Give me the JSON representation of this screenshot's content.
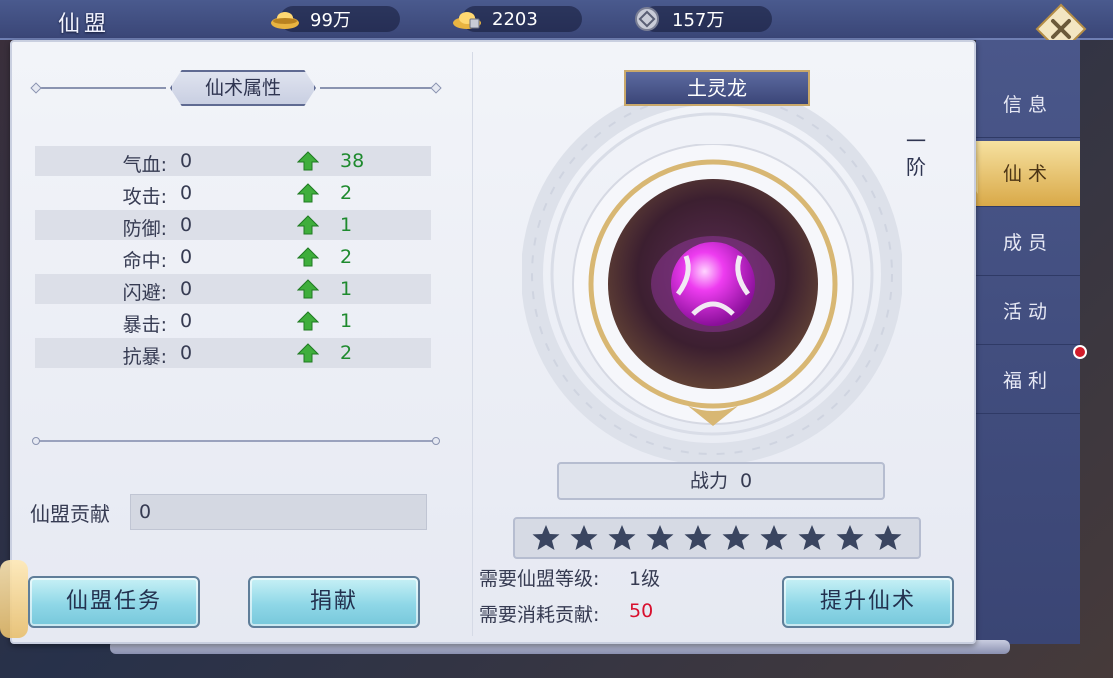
{
  "topbar": {
    "title": "仙盟",
    "resources": [
      {
        "icon": "gold-ingot-icon",
        "value": "99万"
      },
      {
        "icon": "locked-ingot-icon",
        "value": "2203"
      },
      {
        "icon": "coin-icon",
        "value": "157万"
      }
    ]
  },
  "left": {
    "section_title": "仙术属性",
    "attributes": [
      {
        "name": "气血:",
        "value": "0",
        "increase": "38"
      },
      {
        "name": "攻击:",
        "value": "0",
        "increase": "2"
      },
      {
        "name": "防御:",
        "value": "0",
        "increase": "1"
      },
      {
        "name": "命中:",
        "value": "0",
        "increase": "2"
      },
      {
        "name": "闪避:",
        "value": "0",
        "increase": "1"
      },
      {
        "name": "暴击:",
        "value": "0",
        "increase": "1"
      },
      {
        "name": "抗暴:",
        "value": "0",
        "increase": "2"
      }
    ],
    "contribution_label": "仙盟贡献",
    "contribution_value": "0",
    "buttons": {
      "task": "仙盟任务",
      "donate": "捐献"
    }
  },
  "right": {
    "pet_name": "土灵龙",
    "rank": "一阶",
    "power_label": "战力",
    "power_value": "0",
    "stars_total": 10,
    "stars_filled": 0,
    "requirements": [
      {
        "label": "需要仙盟等级:",
        "value": "1级"
      },
      {
        "label": "需要消耗贡献:",
        "value": "50"
      }
    ],
    "upgrade_button": "提升仙术"
  },
  "tabs": [
    {
      "label": "信息"
    },
    {
      "label": "仙术"
    },
    {
      "label": "成员"
    },
    {
      "label": "活动"
    },
    {
      "label": "福利"
    }
  ],
  "active_tab": 1,
  "colors": {
    "accent_gold": "#d9a948",
    "increase_green": "#1e8a2e",
    "cost_red": "#d8102e",
    "panel_bg": "#eceff6"
  }
}
